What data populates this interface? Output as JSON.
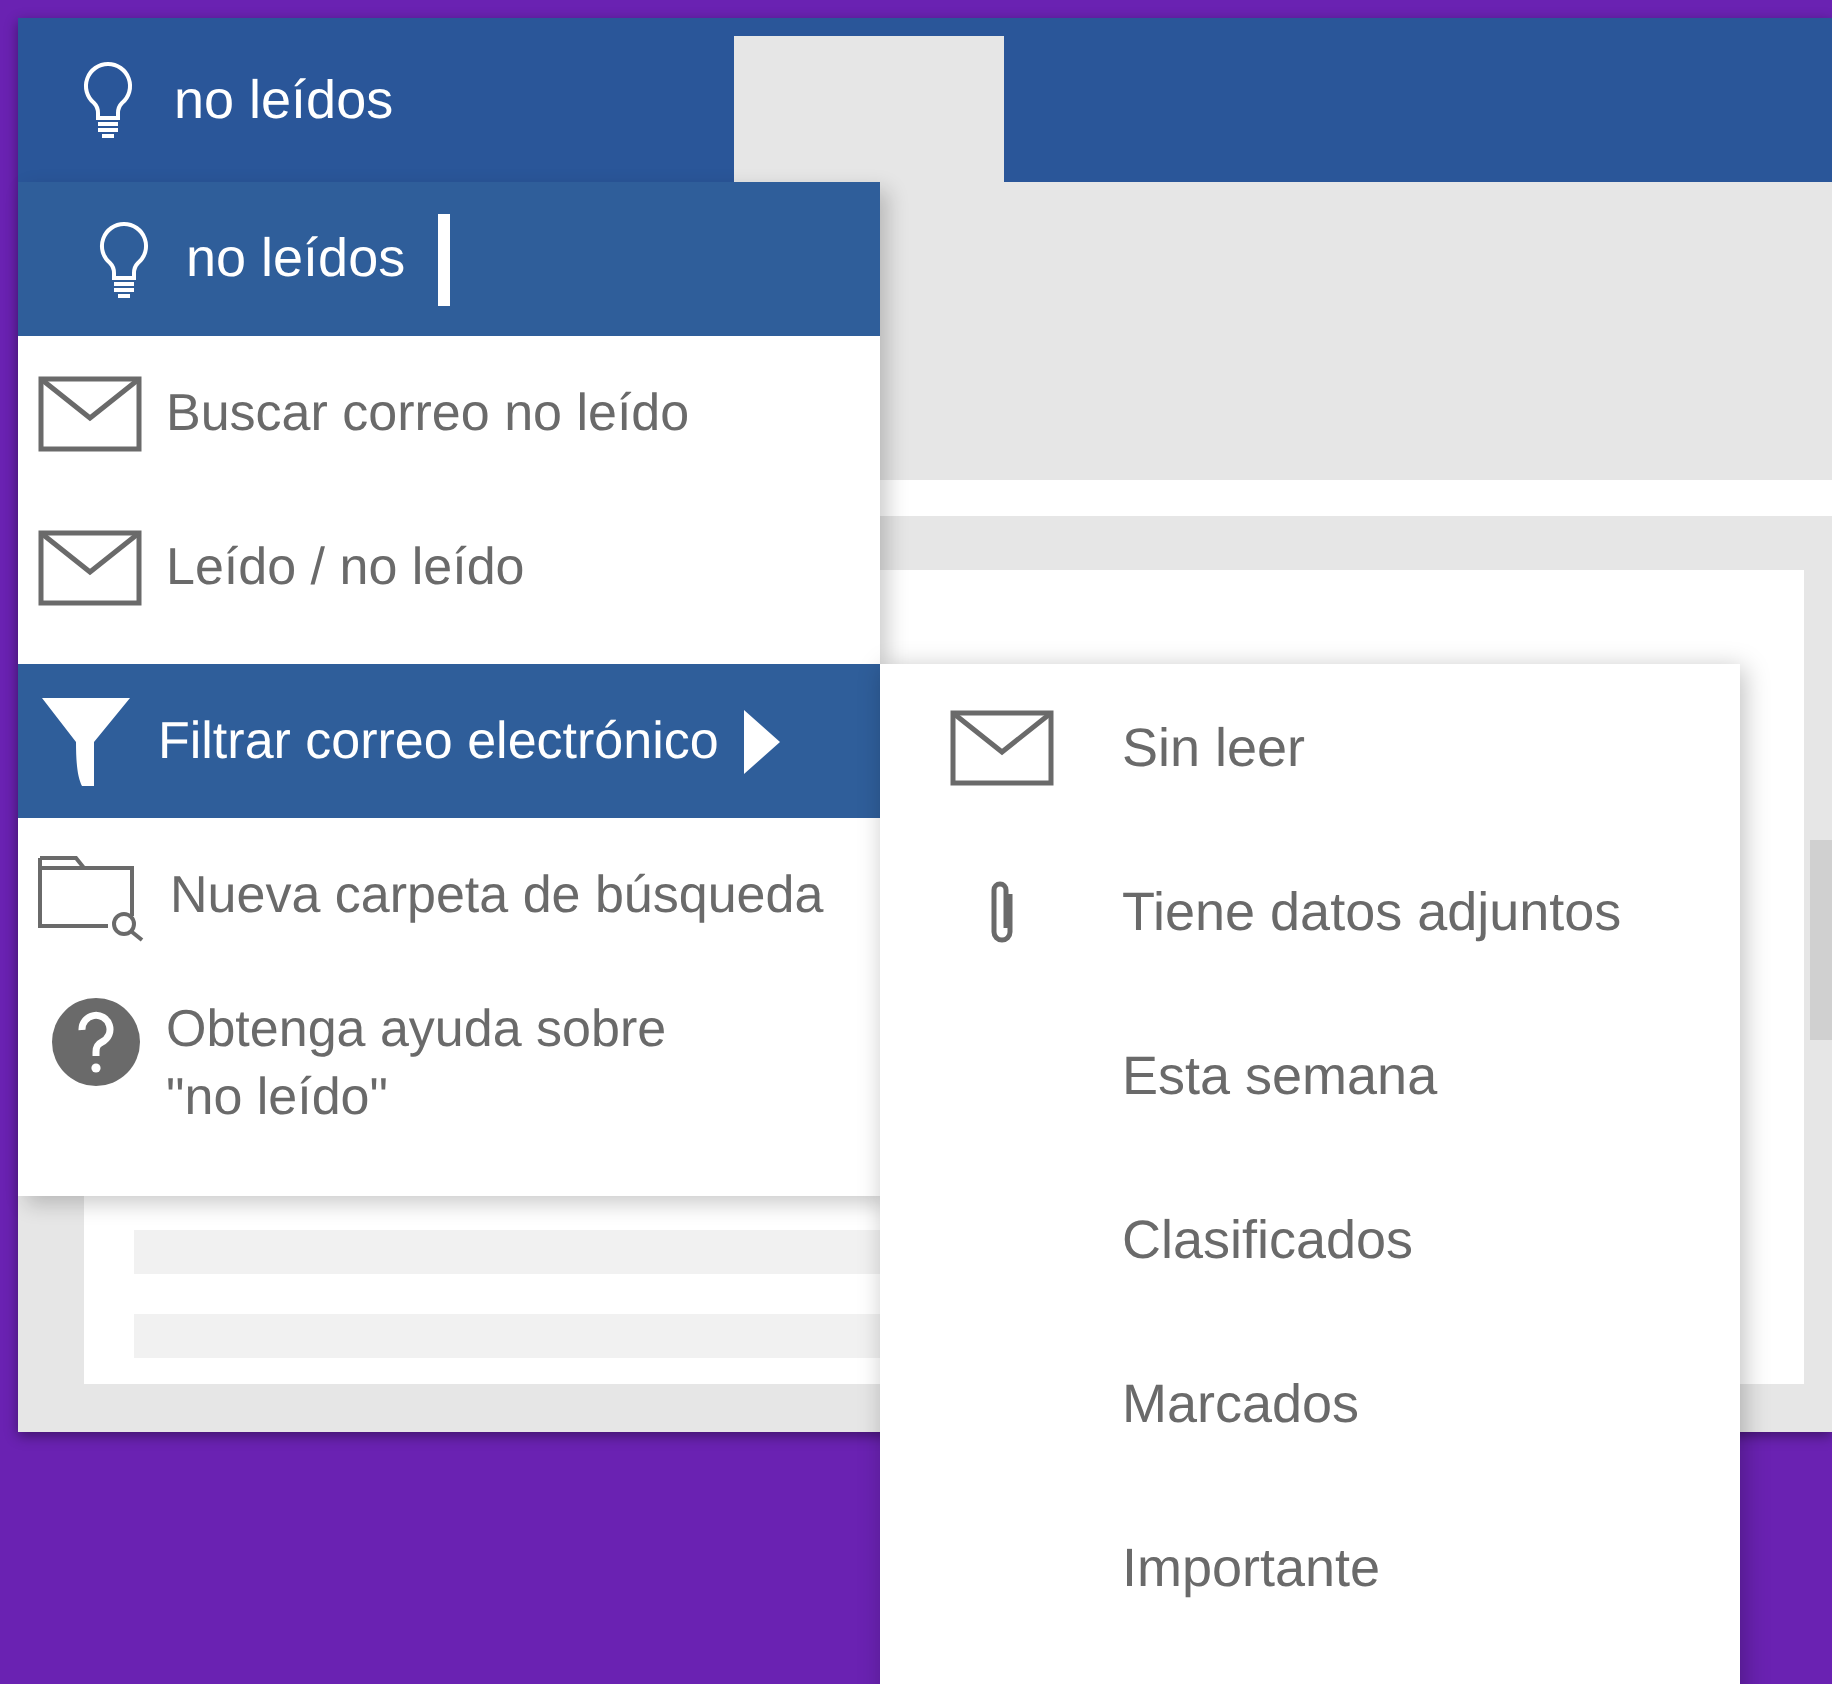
{
  "app_bar": {
    "title": "no leídos"
  },
  "search_menu": {
    "field": {
      "value": "no leídos"
    },
    "items": [
      {
        "label": "Buscar correo no leído",
        "kind": "search",
        "selected": false
      },
      {
        "label": "Leído / no leído",
        "kind": "toggle",
        "selected": false
      },
      {
        "label": "Filtrar correo electrónico",
        "kind": "submenu",
        "selected": true
      },
      {
        "label": "Nueva carpeta de búsqueda",
        "kind": "new-folder",
        "selected": false
      },
      {
        "label": "Obtenga ayuda sobre \"no leído\"",
        "kind": "help",
        "selected": false
      }
    ]
  },
  "filter_submenu": {
    "items": [
      {
        "label": "Sin leer",
        "kind": "unread"
      },
      {
        "label": "Tiene datos adjuntos",
        "kind": "attachments"
      },
      {
        "label": "Esta semana",
        "kind": "plain"
      },
      {
        "label": "Clasificados",
        "kind": "plain"
      },
      {
        "label": "Marcados",
        "kind": "plain"
      },
      {
        "label": "Importante",
        "kind": "plain"
      }
    ]
  }
}
